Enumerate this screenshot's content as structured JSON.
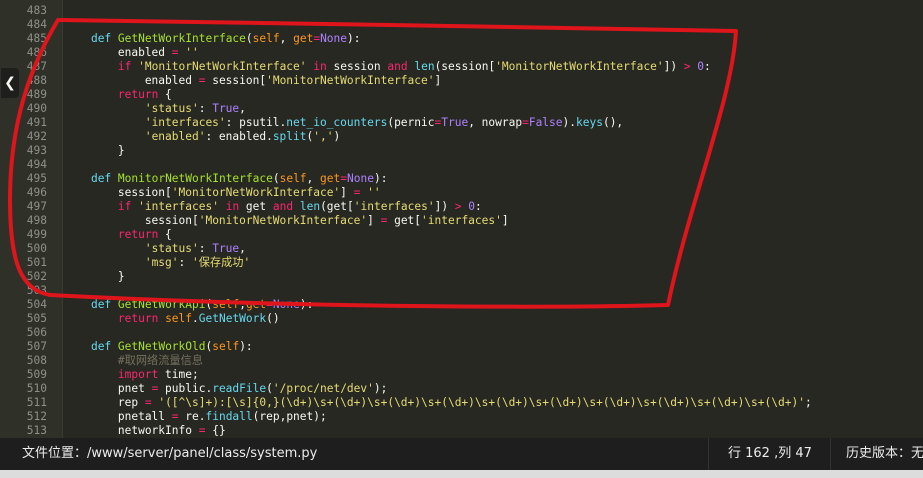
{
  "editor": {
    "collapse_icon": "chevron-left-icon",
    "collapse_glyph": "❮",
    "lines": [
      {
        "n": "483",
        "t": [
          {
            "x": "",
            "c": ""
          }
        ]
      },
      {
        "n": "484",
        "t": [
          {
            "x": "",
            "c": ""
          }
        ]
      },
      {
        "n": "485",
        "t": [
          {
            "x": "    ",
            "c": ""
          },
          {
            "x": "def",
            "c": "df"
          },
          {
            "x": " ",
            "c": ""
          },
          {
            "x": "GetNetWorkInterface",
            "c": "fn"
          },
          {
            "x": "(",
            "c": ""
          },
          {
            "x": "self",
            "c": "p"
          },
          {
            "x": ", ",
            "c": ""
          },
          {
            "x": "get",
            "c": "p"
          },
          {
            "x": "=",
            "c": "k"
          },
          {
            "x": "None",
            "c": "n"
          },
          {
            "x": "):",
            "c": ""
          }
        ]
      },
      {
        "n": "486",
        "t": [
          {
            "x": "        enabled ",
            "c": ""
          },
          {
            "x": "=",
            "c": "k"
          },
          {
            "x": " ",
            "c": ""
          },
          {
            "x": "''",
            "c": "s"
          }
        ]
      },
      {
        "n": "487",
        "t": [
          {
            "x": "        ",
            "c": ""
          },
          {
            "x": "if",
            "c": "k"
          },
          {
            "x": " ",
            "c": ""
          },
          {
            "x": "'MonitorNetWorkInterface'",
            "c": "s"
          },
          {
            "x": " ",
            "c": ""
          },
          {
            "x": "in",
            "c": "k"
          },
          {
            "x": " session ",
            "c": ""
          },
          {
            "x": "and",
            "c": "k"
          },
          {
            "x": " ",
            "c": ""
          },
          {
            "x": "len",
            "c": "b"
          },
          {
            "x": "(session[",
            "c": ""
          },
          {
            "x": "'MonitorNetWorkInterface'",
            "c": "s"
          },
          {
            "x": "]) ",
            "c": ""
          },
          {
            "x": ">",
            "c": "k"
          },
          {
            "x": " ",
            "c": ""
          },
          {
            "x": "0",
            "c": "n"
          },
          {
            "x": ":",
            "c": ""
          }
        ]
      },
      {
        "n": "488",
        "t": [
          {
            "x": "            enabled ",
            "c": ""
          },
          {
            "x": "=",
            "c": "k"
          },
          {
            "x": " session[",
            "c": ""
          },
          {
            "x": "'MonitorNetWorkInterface'",
            "c": "s"
          },
          {
            "x": "]",
            "c": ""
          }
        ]
      },
      {
        "n": "489",
        "t": [
          {
            "x": "        ",
            "c": ""
          },
          {
            "x": "return",
            "c": "k"
          },
          {
            "x": " {",
            "c": ""
          }
        ]
      },
      {
        "n": "490",
        "t": [
          {
            "x": "            ",
            "c": ""
          },
          {
            "x": "'status'",
            "c": "s"
          },
          {
            "x": ": ",
            "c": ""
          },
          {
            "x": "True",
            "c": "n"
          },
          {
            "x": ",",
            "c": ""
          }
        ]
      },
      {
        "n": "491",
        "t": [
          {
            "x": "            ",
            "c": ""
          },
          {
            "x": "'interfaces'",
            "c": "s"
          },
          {
            "x": ": psutil.",
            "c": ""
          },
          {
            "x": "net_io_counters",
            "c": "b"
          },
          {
            "x": "(pernic",
            "c": ""
          },
          {
            "x": "=",
            "c": "k"
          },
          {
            "x": "True",
            "c": "n"
          },
          {
            "x": ", nowrap",
            "c": ""
          },
          {
            "x": "=",
            "c": "k"
          },
          {
            "x": "False",
            "c": "n"
          },
          {
            "x": ").",
            "c": ""
          },
          {
            "x": "keys",
            "c": "b"
          },
          {
            "x": "(),",
            "c": ""
          }
        ]
      },
      {
        "n": "492",
        "t": [
          {
            "x": "            ",
            "c": ""
          },
          {
            "x": "'enabled'",
            "c": "s"
          },
          {
            "x": ": enabled.",
            "c": ""
          },
          {
            "x": "split",
            "c": "b"
          },
          {
            "x": "(",
            "c": ""
          },
          {
            "x": "','",
            "c": "s"
          },
          {
            "x": ")",
            "c": ""
          }
        ]
      },
      {
        "n": "493",
        "t": [
          {
            "x": "        }",
            "c": ""
          }
        ]
      },
      {
        "n": "494",
        "t": [
          {
            "x": "",
            "c": ""
          }
        ]
      },
      {
        "n": "495",
        "t": [
          {
            "x": "    ",
            "c": ""
          },
          {
            "x": "def",
            "c": "df"
          },
          {
            "x": " ",
            "c": ""
          },
          {
            "x": "MonitorNetWorkInterface",
            "c": "fn"
          },
          {
            "x": "(",
            "c": ""
          },
          {
            "x": "self",
            "c": "p"
          },
          {
            "x": ", ",
            "c": ""
          },
          {
            "x": "get",
            "c": "p"
          },
          {
            "x": "=",
            "c": "k"
          },
          {
            "x": "None",
            "c": "n"
          },
          {
            "x": "):",
            "c": ""
          }
        ]
      },
      {
        "n": "496",
        "t": [
          {
            "x": "        session[",
            "c": ""
          },
          {
            "x": "'MonitorNetWorkInterface'",
            "c": "s"
          },
          {
            "x": "] ",
            "c": ""
          },
          {
            "x": "=",
            "c": "k"
          },
          {
            "x": " ",
            "c": ""
          },
          {
            "x": "''",
            "c": "s"
          }
        ]
      },
      {
        "n": "497",
        "t": [
          {
            "x": "        ",
            "c": ""
          },
          {
            "x": "if",
            "c": "k"
          },
          {
            "x": " ",
            "c": ""
          },
          {
            "x": "'interfaces'",
            "c": "s"
          },
          {
            "x": " ",
            "c": ""
          },
          {
            "x": "in",
            "c": "k"
          },
          {
            "x": " get ",
            "c": ""
          },
          {
            "x": "and",
            "c": "k"
          },
          {
            "x": " ",
            "c": ""
          },
          {
            "x": "len",
            "c": "b"
          },
          {
            "x": "(get[",
            "c": ""
          },
          {
            "x": "'interfaces'",
            "c": "s"
          },
          {
            "x": "]) ",
            "c": ""
          },
          {
            "x": ">",
            "c": "k"
          },
          {
            "x": " ",
            "c": ""
          },
          {
            "x": "0",
            "c": "n"
          },
          {
            "x": ":",
            "c": ""
          }
        ]
      },
      {
        "n": "498",
        "t": [
          {
            "x": "            session[",
            "c": ""
          },
          {
            "x": "'MonitorNetWorkInterface'",
            "c": "s"
          },
          {
            "x": "] ",
            "c": ""
          },
          {
            "x": "=",
            "c": "k"
          },
          {
            "x": " get[",
            "c": ""
          },
          {
            "x": "'interfaces'",
            "c": "s"
          },
          {
            "x": "]",
            "c": ""
          }
        ]
      },
      {
        "n": "499",
        "t": [
          {
            "x": "        ",
            "c": ""
          },
          {
            "x": "return",
            "c": "k"
          },
          {
            "x": " {",
            "c": ""
          }
        ]
      },
      {
        "n": "500",
        "t": [
          {
            "x": "            ",
            "c": ""
          },
          {
            "x": "'status'",
            "c": "s"
          },
          {
            "x": ": ",
            "c": ""
          },
          {
            "x": "True",
            "c": "n"
          },
          {
            "x": ",",
            "c": ""
          }
        ]
      },
      {
        "n": "501",
        "t": [
          {
            "x": "            ",
            "c": ""
          },
          {
            "x": "'msg'",
            "c": "s"
          },
          {
            "x": ": ",
            "c": ""
          },
          {
            "x": "'保存成功'",
            "c": "s"
          }
        ]
      },
      {
        "n": "502",
        "t": [
          {
            "x": "        }",
            "c": ""
          }
        ]
      },
      {
        "n": "503",
        "t": [
          {
            "x": "",
            "c": ""
          }
        ]
      },
      {
        "n": "504",
        "t": [
          {
            "x": "    ",
            "c": ""
          },
          {
            "x": "def",
            "c": "df"
          },
          {
            "x": " ",
            "c": ""
          },
          {
            "x": "GetNetWorkApi",
            "c": "fn"
          },
          {
            "x": "(",
            "c": ""
          },
          {
            "x": "self",
            "c": "p"
          },
          {
            "x": ",",
            "c": ""
          },
          {
            "x": "get",
            "c": "p"
          },
          {
            "x": "=",
            "c": "k"
          },
          {
            "x": "None",
            "c": "n"
          },
          {
            "x": "):",
            "c": ""
          }
        ]
      },
      {
        "n": "505",
        "t": [
          {
            "x": "        ",
            "c": ""
          },
          {
            "x": "return",
            "c": "k"
          },
          {
            "x": " ",
            "c": ""
          },
          {
            "x": "self",
            "c": "p"
          },
          {
            "x": ".",
            "c": ""
          },
          {
            "x": "GetNetWork",
            "c": "b"
          },
          {
            "x": "()",
            "c": ""
          }
        ]
      },
      {
        "n": "506",
        "t": [
          {
            "x": "",
            "c": ""
          }
        ]
      },
      {
        "n": "507",
        "t": [
          {
            "x": "    ",
            "c": ""
          },
          {
            "x": "def",
            "c": "df"
          },
          {
            "x": " ",
            "c": ""
          },
          {
            "x": "GetNetWorkOld",
            "c": "fn"
          },
          {
            "x": "(",
            "c": ""
          },
          {
            "x": "self",
            "c": "p"
          },
          {
            "x": "):",
            "c": ""
          }
        ]
      },
      {
        "n": "508",
        "t": [
          {
            "x": "        ",
            "c": ""
          },
          {
            "x": "#取网络流量信息",
            "c": "c"
          }
        ]
      },
      {
        "n": "509",
        "t": [
          {
            "x": "        ",
            "c": ""
          },
          {
            "x": "import",
            "c": "k"
          },
          {
            "x": " time;",
            "c": ""
          }
        ]
      },
      {
        "n": "510",
        "t": [
          {
            "x": "        pnet ",
            "c": ""
          },
          {
            "x": "=",
            "c": "k"
          },
          {
            "x": " public.",
            "c": ""
          },
          {
            "x": "readFile",
            "c": "b"
          },
          {
            "x": "(",
            "c": ""
          },
          {
            "x": "'/proc/net/dev'",
            "c": "s"
          },
          {
            "x": ");",
            "c": ""
          }
        ]
      },
      {
        "n": "511",
        "t": [
          {
            "x": "        rep ",
            "c": ""
          },
          {
            "x": "=",
            "c": "k"
          },
          {
            "x": " ",
            "c": ""
          },
          {
            "x": "'([^\\s]+):[\\s]{0,}(\\d+)\\s+(\\d+)\\s+(\\d+)\\s+(\\d+)\\s+(\\d+)\\s+(\\d+)\\s+(\\d+)\\s+(\\d+)\\s+(\\d+)\\s+(\\d+)'",
            "c": "s"
          },
          {
            "x": ";",
            "c": ""
          }
        ]
      },
      {
        "n": "512",
        "t": [
          {
            "x": "        pnetall ",
            "c": ""
          },
          {
            "x": "=",
            "c": "k"
          },
          {
            "x": " re.",
            "c": ""
          },
          {
            "x": "findall",
            "c": "b"
          },
          {
            "x": "(rep,pnet);",
            "c": ""
          }
        ]
      },
      {
        "n": "513",
        "t": [
          {
            "x": "        networkInfo ",
            "c": ""
          },
          {
            "x": "=",
            "c": "k"
          },
          {
            "x": " {}",
            "c": ""
          }
        ]
      }
    ]
  },
  "statusbar": {
    "file_location": "文件位置：/www/server/panel/class/system.py",
    "cursor_position": "行 162 ,列 47",
    "history": "历史版本：无"
  },
  "colors": {
    "editor_bg": "#272822",
    "annotation_red": "#e0141b"
  }
}
